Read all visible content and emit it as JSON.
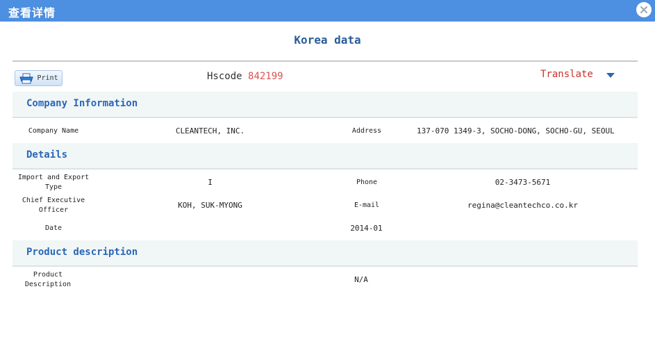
{
  "window": {
    "title": "查看详情"
  },
  "page": {
    "heading": "Korea data"
  },
  "toolbar": {
    "print_label": "Print",
    "hscode_label": "Hscode",
    "hscode_value": "842199",
    "translate_label": "Translate"
  },
  "sections": {
    "company": {
      "title": "Company Information",
      "company_name_label": "Company Name",
      "company_name": "CLEANTECH, INC.",
      "address_label": "Address",
      "address": "137-070 1349-3, SOCHO-DONG, SOCHO-GU, SEOUL"
    },
    "details": {
      "title": "Details",
      "ie_type_label": "Import and Export Type",
      "ie_type": "I",
      "phone_label": "Phone",
      "phone": "02-3473-5671",
      "ceo_label": "Chief Executive Officer",
      "ceo": "KOH, SUK-MYONG",
      "email_label": "E-mail",
      "email": "regina@cleantechco.co.kr",
      "date_label": "Date",
      "date": "2014-01"
    },
    "product": {
      "title": "Product description",
      "desc_label": "Product Description",
      "desc": "N/A"
    }
  },
  "icons": {
    "close": "close-icon",
    "print": "printer-icon",
    "dropdown": "caret-down-icon"
  },
  "colors": {
    "titlebar": "#4d8fe0",
    "accent": "#2a66b8",
    "code": "#d9534f"
  }
}
